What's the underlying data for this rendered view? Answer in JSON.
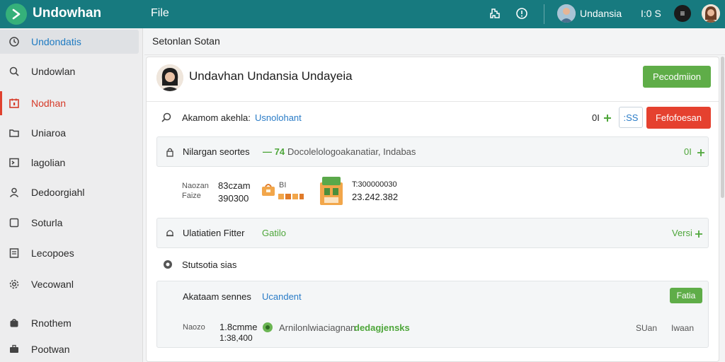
{
  "app": {
    "title": "Undowhan",
    "menu_file": "File",
    "user_name": "Undansia",
    "count": "I:0 S",
    "dark_badge": "≡"
  },
  "sidebar": {
    "items": [
      {
        "label": "Undondatis",
        "icon": "clock-icon"
      },
      {
        "label": "Undowlan",
        "icon": "search-icon"
      },
      {
        "label": "Nodhan",
        "icon": "calendar-icon"
      },
      {
        "label": "Uniaroa",
        "icon": "folder-icon"
      },
      {
        "label": "lagolian",
        "icon": "terminal-icon"
      },
      {
        "label": "Dedoorgiahl",
        "icon": "user-icon"
      },
      {
        "label": "Soturla",
        "icon": "square-icon"
      },
      {
        "label": "Lecopoes",
        "icon": "list-icon"
      },
      {
        "label": "Vecowanl",
        "icon": "settings-icon"
      },
      {
        "label": "Rnothem",
        "icon": "bag-icon"
      },
      {
        "label": "Pootwan",
        "icon": "briefcase-icon"
      }
    ]
  },
  "main": {
    "header_title": "Setonlan Sotan",
    "card": {
      "title": "Undavhan Undansia Undayeia",
      "top_button": "Pecodmiion",
      "search_row": {
        "label": "Akamom akehla:",
        "value": "Usnolohant",
        "count": "0I",
        "chip": ":SS",
        "red_button": "Fefofoesan"
      },
      "panel1": {
        "label": "Nilargan seortes",
        "badge": "— 74",
        "desc": "Docolelologoakanatiar, Indabas",
        "right": "0I"
      },
      "stats": {
        "label1": "Naozan",
        "label2": "Faize",
        "val1": "83czam",
        "val2": "390300",
        "mid": "BI",
        "num1": "T:300000030",
        "num2": "23.242.382"
      },
      "panel2": {
        "label": "Ulatiatien Fitter",
        "value": "Gatilo",
        "right": "Versi"
      },
      "section_title": "Stutsotia sias",
      "panel3": {
        "label": "Akataam sennes",
        "value": "Ucandent",
        "button": "Fatia",
        "sub_label": "Naozo",
        "sub_val1": "1.8cmme",
        "sub_val2": "1:38,400",
        "desc_plain": "Arnilonlwiaciagnan",
        "desc_green": "dedagjensks",
        "right1": "SUan",
        "right2": "Iwaan"
      }
    }
  },
  "colors": {
    "topbar": "#177a7f",
    "green": "#5fad48",
    "red": "#e5412f",
    "blue": "#2a7cc7"
  }
}
